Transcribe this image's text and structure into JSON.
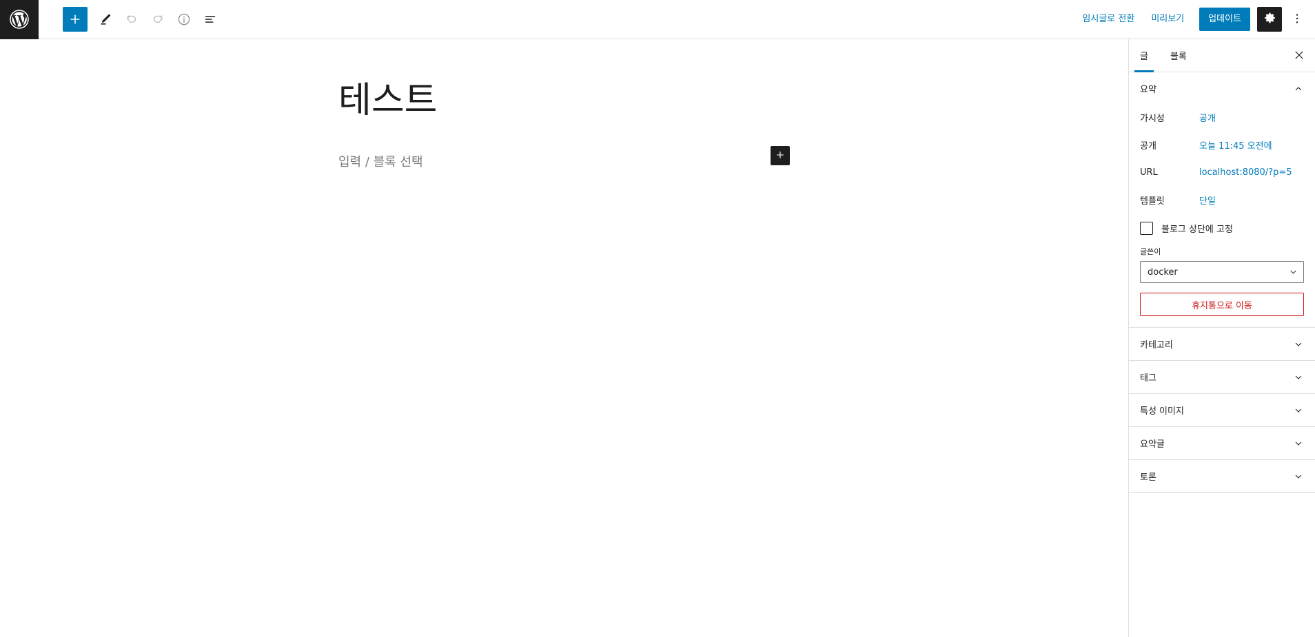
{
  "topbar": {
    "logo_icon": "wordpress-logo-icon",
    "left_tools": [
      {
        "icon": "plus-icon",
        "name": "add-block-button",
        "style": "primary",
        "disabled": false
      },
      {
        "icon": "pencil-icon",
        "name": "tools-edit-button",
        "style": "plain",
        "disabled": false
      },
      {
        "icon": "undo-arrow-icon",
        "name": "undo-button",
        "style": "plain",
        "disabled": true
      },
      {
        "icon": "redo-arrow-icon",
        "name": "redo-button",
        "style": "plain",
        "disabled": true
      },
      {
        "icon": "info-circle-icon",
        "name": "details-button",
        "style": "plain",
        "disabled": false
      },
      {
        "icon": "list-view-icon",
        "name": "list-view-button",
        "style": "plain",
        "disabled": false
      }
    ],
    "switch_to_draft_label": "임시글로 전환",
    "preview_label": "미리보기",
    "update_label": "업데이트",
    "settings_icon": "gear-icon",
    "more_icon": "three-dots-vertical-icon"
  },
  "editor": {
    "post_title": "테스트",
    "block_placeholder": "입력 / 블록 선택",
    "appender_icon": "plus-icon"
  },
  "sidebar": {
    "tabs": [
      {
        "label": "글",
        "active": true
      },
      {
        "label": "블록",
        "active": false
      }
    ],
    "close_icon": "close-x-icon",
    "summary": {
      "title": "요약",
      "expanded": true,
      "chevron_icon": "chevron-up-icon",
      "rows": [
        {
          "label": "가시성",
          "value": "공개"
        },
        {
          "label": "공개",
          "value": "오늘 11:45 오전에"
        },
        {
          "label": "URL",
          "value": "localhost:8080/?p=5"
        },
        {
          "label": "템플릿",
          "value": "단일"
        }
      ],
      "sticky_checkbox_label": "블로그 상단에 고정",
      "sticky_checked": false,
      "author_field_label": "글쓴이",
      "author_value": "docker",
      "author_options": [
        "docker"
      ],
      "trash_label": "휴지통으로 이동"
    },
    "panels": [
      {
        "label": "카테고리",
        "chevron_icon": "chevron-down-icon"
      },
      {
        "label": "태그",
        "chevron_icon": "chevron-down-icon"
      },
      {
        "label": "특성 이미지",
        "chevron_icon": "chevron-down-icon"
      },
      {
        "label": "요약글",
        "chevron_icon": "chevron-down-icon"
      },
      {
        "label": "토론",
        "chevron_icon": "chevron-down-icon"
      }
    ]
  },
  "colors": {
    "accent_blue": "#007cba",
    "dark": "#1e1e1e",
    "danger_red": "#cc1818",
    "border": "#e0e0e0",
    "muted_text": "#7a7a7a"
  }
}
